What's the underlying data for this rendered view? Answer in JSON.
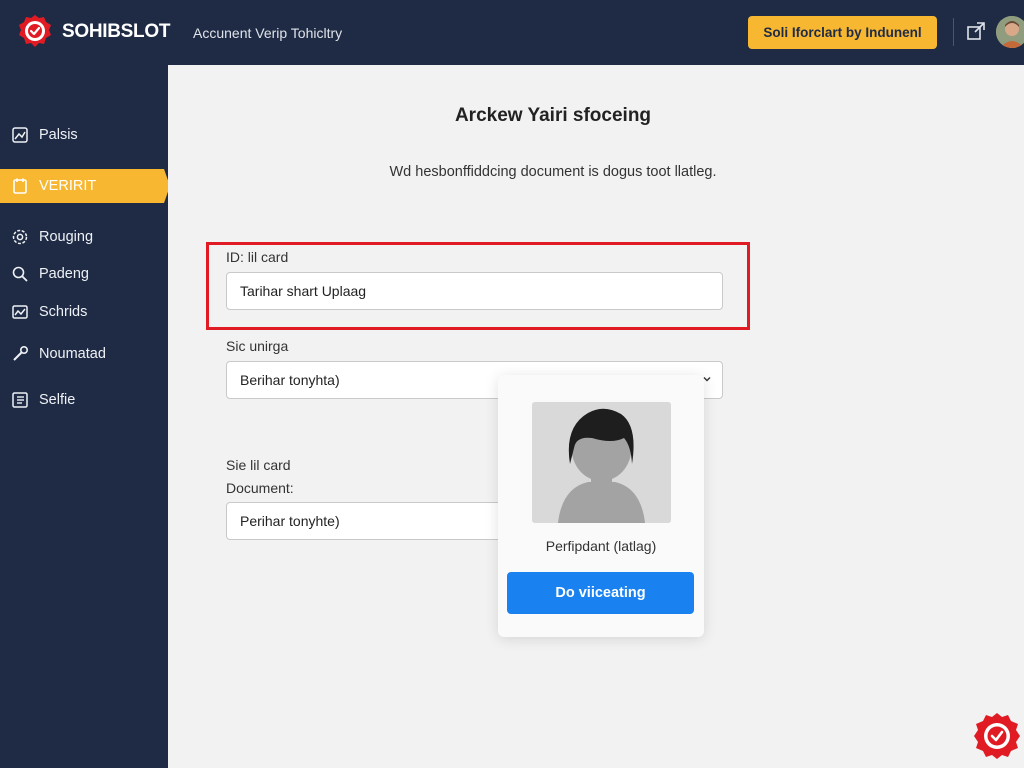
{
  "header": {
    "brand": "SOHIBSLOT",
    "subtitle": "Accunent Verip Tohicltry",
    "cta_label": "Soli Iforclart by Indunenl"
  },
  "icons": {
    "logo": "shield-check-badge-icon",
    "external": "external-link-icon",
    "avatar": "user-avatar",
    "corner": "shield-check-badge-icon"
  },
  "colors": {
    "topbar": "#1f2b44",
    "sidebar": "#1f2b44",
    "accent": "#f7b731",
    "brand_red": "#e01b24",
    "primary_button": "#1a82f0"
  },
  "sidebar": {
    "items": [
      {
        "label": "Palsis",
        "icon": "image-icon",
        "active": false
      },
      {
        "label": "VERIRIT",
        "icon": "document-icon",
        "active": true
      },
      {
        "label": "Rouging",
        "icon": "settings-icon",
        "active": false
      },
      {
        "label": "Padeng",
        "icon": "search-icon",
        "active": false
      },
      {
        "label": "Schrids",
        "icon": "chart-icon",
        "active": false
      },
      {
        "label": "Noumatad",
        "icon": "wrench-icon",
        "active": false
      },
      {
        "label": "Selfie",
        "icon": "checklist-icon",
        "active": false
      }
    ]
  },
  "main": {
    "title": "Arckew Yairi sfoceing",
    "description": "Wd hesbonffiddcing document is dogus toot llatleg.",
    "fields": [
      {
        "label": "ID: lil card",
        "value": "Tarihar shart Uplaag"
      },
      {
        "label": "Sic unirga",
        "value": "Berihar tonyhta)"
      },
      {
        "label": "Sie lil card",
        "label2": "Document:",
        "value": "Perihar tonyhte)"
      }
    ],
    "selfie": {
      "caption": "Perfipdant (latlag)",
      "button_label": "Do viiceating"
    }
  }
}
